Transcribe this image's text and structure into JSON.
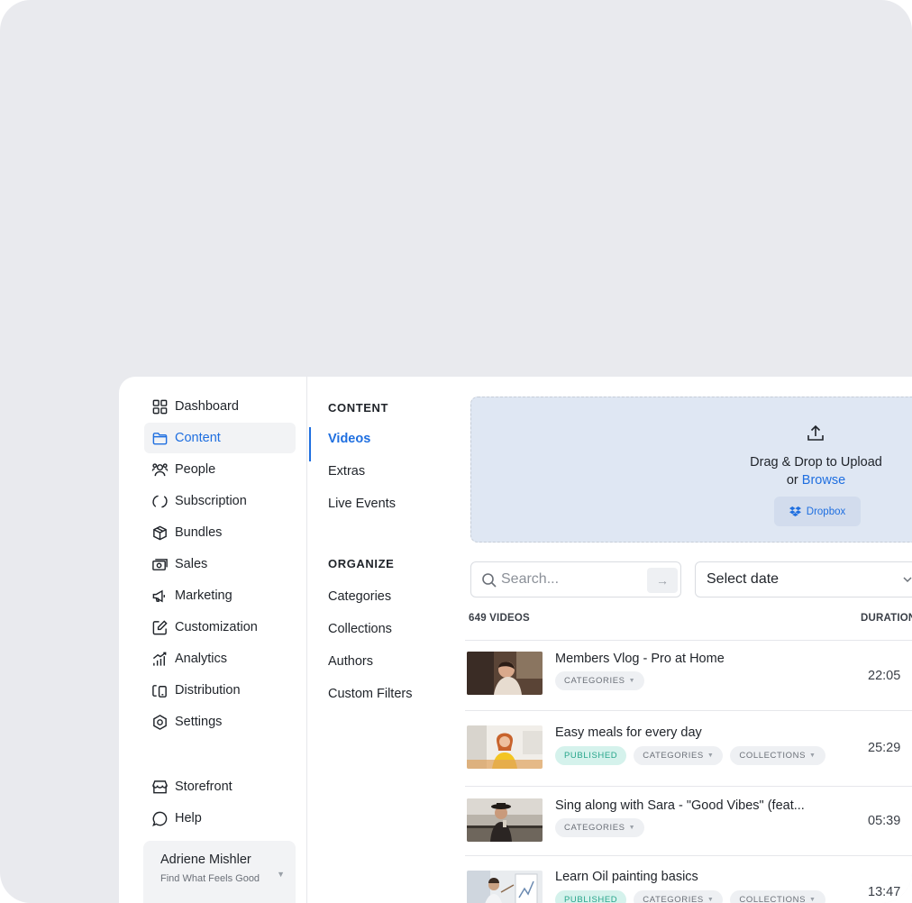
{
  "sidebar": {
    "items": [
      {
        "label": "Dashboard",
        "icon": "grid-icon"
      },
      {
        "label": "Content",
        "icon": "folder-icon",
        "active": true
      },
      {
        "label": "People",
        "icon": "people-icon"
      },
      {
        "label": "Subscription",
        "icon": "refresh-icon"
      },
      {
        "label": "Bundles",
        "icon": "box-icon"
      },
      {
        "label": "Sales",
        "icon": "cash-icon"
      },
      {
        "label": "Marketing",
        "icon": "megaphone-icon"
      },
      {
        "label": "Customization",
        "icon": "edit-icon"
      },
      {
        "label": "Analytics",
        "icon": "analytics-icon"
      },
      {
        "label": "Distribution",
        "icon": "devices-icon"
      },
      {
        "label": "Settings",
        "icon": "settings-icon"
      }
    ],
    "bottom_items": [
      {
        "label": "Storefront",
        "icon": "storefront-icon"
      },
      {
        "label": "Help",
        "icon": "help-icon"
      }
    ],
    "user": {
      "name": "Adriene Mishler",
      "subtitle": "Find What Feels Good"
    }
  },
  "subnav": {
    "content_heading": "CONTENT",
    "content_items": [
      {
        "label": "Videos",
        "active": true
      },
      {
        "label": "Extras"
      },
      {
        "label": "Live Events"
      }
    ],
    "organize_heading": "ORGANIZE",
    "organize_items": [
      {
        "label": "Categories"
      },
      {
        "label": "Collections"
      },
      {
        "label": "Authors"
      },
      {
        "label": "Custom Filters"
      }
    ]
  },
  "upload": {
    "title": "Drag & Drop to Upload",
    "or_text": "or",
    "browse_label": "Browse",
    "dropbox_label": "Dropbox"
  },
  "filters": {
    "search_placeholder": "Search...",
    "date_select_value": "Select date"
  },
  "list": {
    "count_label": "649 VIDEOS",
    "duration_header": "DURATION",
    "tag_labels": {
      "published": "PUBLISHED",
      "categories": "CATEGORIES",
      "collections": "COLLECTIONS"
    },
    "rows": [
      {
        "title": "Members Vlog - Pro at Home",
        "duration": "22:05",
        "published": false,
        "collections": false
      },
      {
        "title": "Easy meals for every day",
        "duration": "25:29",
        "published": true,
        "collections": true
      },
      {
        "title": "Sing along with Sara - \"Good Vibes\" (feat...",
        "duration": "05:39",
        "published": false,
        "collections": false
      },
      {
        "title": "Learn Oil painting basics",
        "duration": "13:47",
        "published": true,
        "collections": true
      }
    ]
  },
  "colors": {
    "accent": "#1f6fe0",
    "published_bg": "#d5f2ec",
    "published_text": "#27a58b",
    "upload_bg": "#dfe7f3",
    "backdrop": "#e9eaee"
  }
}
